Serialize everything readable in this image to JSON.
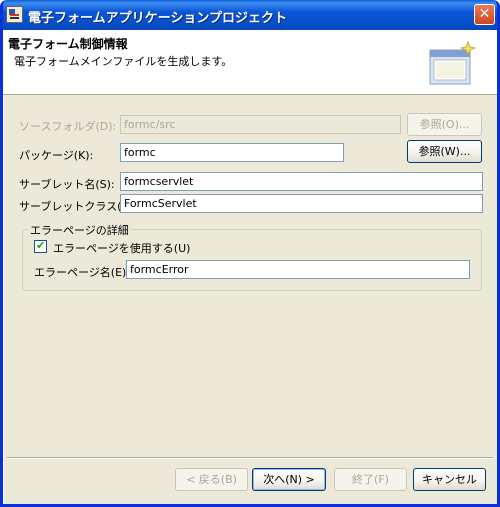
{
  "window": {
    "title": "電子フォームアプリケーションプロジェクト",
    "close_label": "✕"
  },
  "header": {
    "title": "電子フォーム制御情報",
    "description": "電子フォームメインファイルを生成します。"
  },
  "form": {
    "source_folder": {
      "label": "ソースフォルダ(D):",
      "value": "formc/src",
      "button": "参照(O)..."
    },
    "package": {
      "label": "パッケージ(K):",
      "value": "formc",
      "button": "参照(W)..."
    },
    "servlet_name": {
      "label": "サーブレット名(S):",
      "value": "formcservlet"
    },
    "servlet_class": {
      "label": "サーブレットクラス(C):",
      "value": "FormcServlet"
    }
  },
  "error_page": {
    "group_label": "エラーページの詳細",
    "use_checkbox": {
      "label": "エラーページを使用する(U)",
      "checked": true
    },
    "name": {
      "label": "エラーページ名(E):",
      "value": "formcError"
    }
  },
  "buttons": {
    "back": "< 戻る(B)",
    "next": "次へ(N) >",
    "finish": "終了(F)",
    "cancel": "キャンセル"
  }
}
